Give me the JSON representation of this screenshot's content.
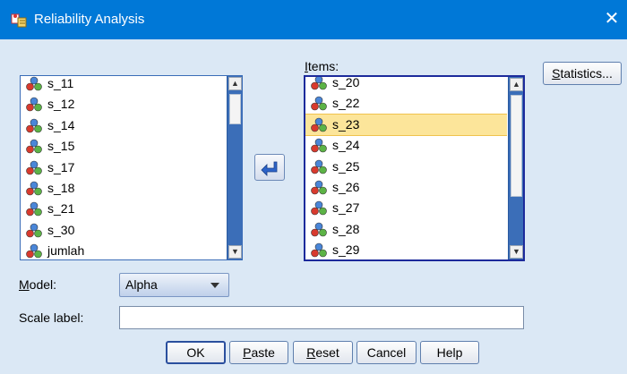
{
  "window": {
    "title": "Reliability Analysis",
    "close_glyph": "✕"
  },
  "available_vars": {
    "items": [
      "s_11",
      "s_12",
      "s_14",
      "s_15",
      "s_17",
      "s_18",
      "s_21",
      "s_30",
      "jumlah"
    ]
  },
  "items_panel": {
    "label_prefix": "I",
    "label_rest": "tems:",
    "items": [
      "s_20",
      "s_22",
      "s_23",
      "s_24",
      "s_25",
      "s_26",
      "s_27",
      "s_28",
      "s_29"
    ],
    "selected": "s_23"
  },
  "buttons": {
    "statistics_u": "S",
    "statistics_rest": "tatistics...",
    "ok": "OK",
    "paste_u": "P",
    "paste_rest": "aste",
    "reset_u": "R",
    "reset_rest": "eset",
    "cancel": "Cancel",
    "help": "Help"
  },
  "model": {
    "label_u": "M",
    "label_rest": "odel:",
    "value": "Alpha"
  },
  "scale_label": {
    "label": "Scale label:",
    "value": ""
  },
  "icons": {
    "variable": "scale-variable-icon",
    "move": "move-arrow-icon",
    "app": "spss-dialog-icon"
  },
  "colors": {
    "titlebar": "#0078d7",
    "background": "#dbe8f5",
    "selection": "#fce59a",
    "scrollbar": "#3b6eb8"
  }
}
